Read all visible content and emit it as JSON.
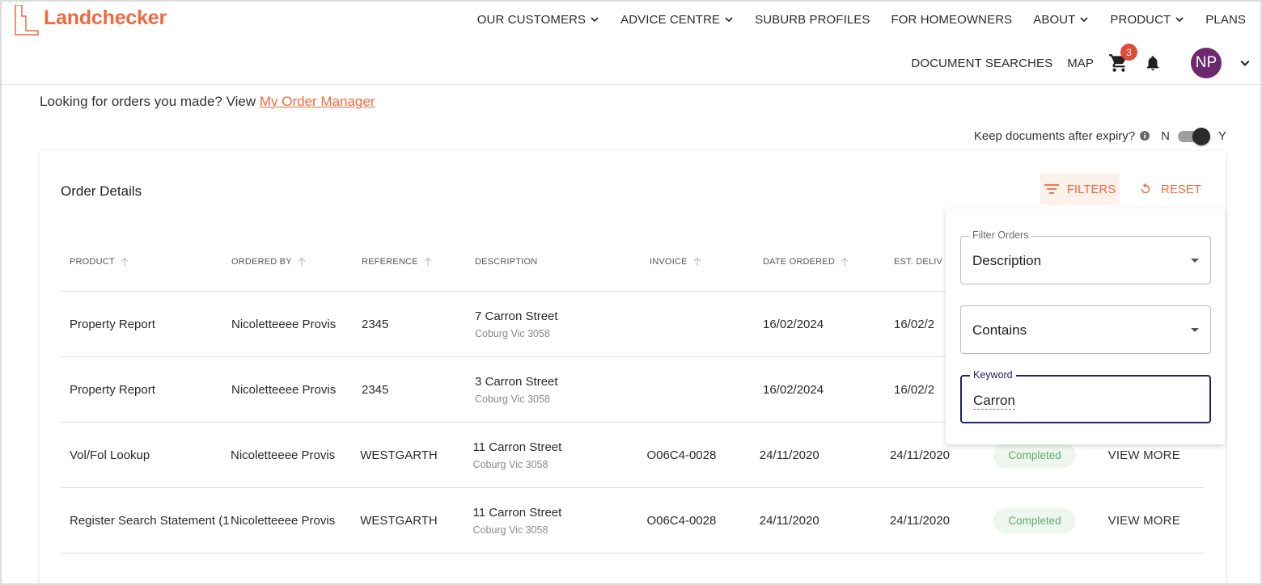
{
  "brand": {
    "name": "Landchecker",
    "color": "#ee6a3e"
  },
  "nav": {
    "top": [
      {
        "label": "OUR CUSTOMERS",
        "dropdown": true
      },
      {
        "label": "ADVICE CENTRE",
        "dropdown": true
      },
      {
        "label": "SUBURB PROFILES",
        "dropdown": false
      },
      {
        "label": "FOR HOMEOWNERS",
        "dropdown": false
      },
      {
        "label": "ABOUT",
        "dropdown": true
      },
      {
        "label": "PRODUCT",
        "dropdown": true
      },
      {
        "label": "PLANS",
        "dropdown": false
      }
    ],
    "document_searches": "DOCUMENT SEARCHES",
    "map": "MAP",
    "cart_count": "3",
    "avatar_initials": "NP"
  },
  "lookup": {
    "prefix": "Looking for orders you made? View ",
    "link": "My Order Manager"
  },
  "keep_docs": {
    "label": "Keep documents after expiry?",
    "no": "N",
    "yes": "Y",
    "enabled": true
  },
  "card": {
    "title": "Order Details",
    "filters_label": "FILTERS",
    "reset_label": "RESET"
  },
  "table": {
    "columns": [
      "PRODUCT",
      "ORDERED BY",
      "REFERENCE",
      "DESCRIPTION",
      "INVOICE",
      "DATE ORDERED",
      "EST. DELIV"
    ],
    "rows": [
      {
        "product": "Property Report",
        "ordered_by": "Nicoletteeee Provis",
        "reference": "2345",
        "desc_main": "7 Carron Street",
        "desc_sub": "Coburg Vic 3058",
        "invoice": "",
        "date_ordered": "16/02/2024",
        "est_delivery": "16/02/2",
        "status": "",
        "action": ""
      },
      {
        "product": "Property Report",
        "ordered_by": "Nicoletteeee Provis",
        "reference": "2345",
        "desc_main": "3 Carron Street",
        "desc_sub": "Coburg Vic 3058",
        "invoice": "",
        "date_ordered": "16/02/2024",
        "est_delivery": "16/02/2",
        "status": "",
        "action": ""
      },
      {
        "product": "Vol/Fol Lookup",
        "ordered_by": "Nicoletteeee Provis",
        "reference": "WESTGARTH",
        "desc_main": "11 Carron Street",
        "desc_sub": "Coburg Vic 3058",
        "invoice": "O06C4-0028",
        "date_ordered": "24/11/2020",
        "est_delivery": "24/11/2020",
        "status": "Completed",
        "action": "VIEW MORE"
      },
      {
        "product": "Register Search Statement (1",
        "ordered_by": "Nicoletteeee Provis",
        "reference": "WESTGARTH",
        "desc_main": "11 Carron Street",
        "desc_sub": "Coburg Vic 3058",
        "invoice": "O06C4-0028",
        "date_ordered": "24/11/2020",
        "est_delivery": "24/11/2020",
        "status": "Completed",
        "action": "VIEW MORE"
      }
    ]
  },
  "filter_panel": {
    "filter_orders_label": "Filter Orders",
    "filter_orders_value": "Description",
    "operator_value": "Contains",
    "keyword_label": "Keyword",
    "keyword_value": "Carron"
  }
}
